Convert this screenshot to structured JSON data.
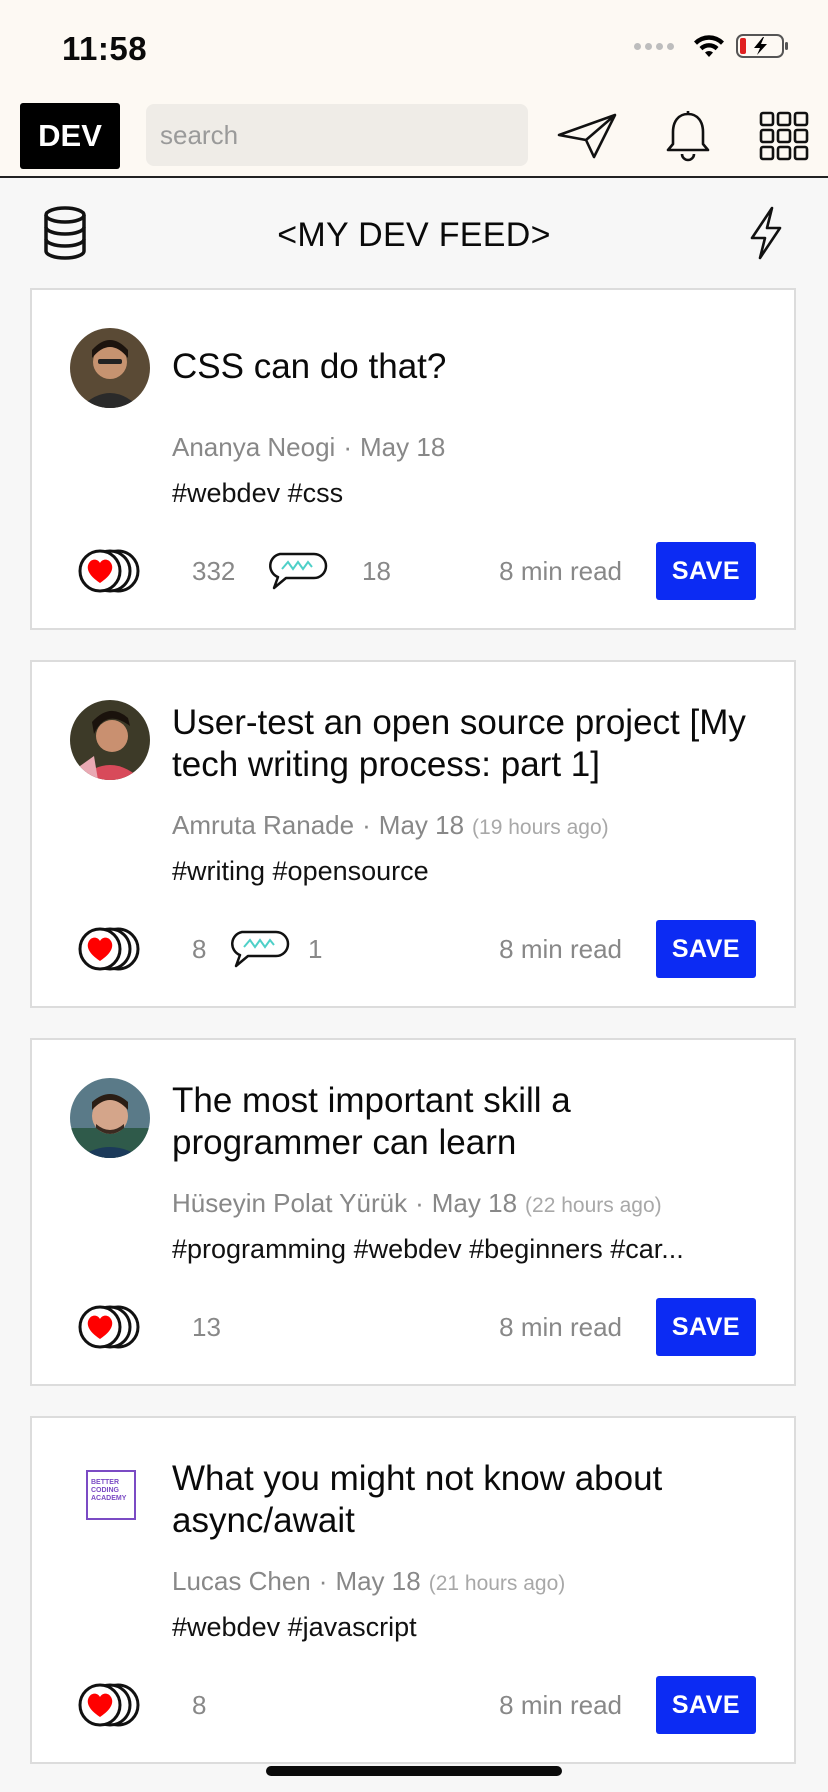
{
  "status_bar": {
    "time": "11:58"
  },
  "top_bar": {
    "logo": "DEV",
    "search_placeholder": "search",
    "icons": [
      "send-icon",
      "bell-icon",
      "grid-menu-icon"
    ]
  },
  "feed": {
    "title": "<MY DEV FEED>",
    "left_icon": "database-icon",
    "right_icon": "lightning-icon"
  },
  "posts": [
    {
      "title": "CSS can do that?",
      "author": "Ananya Neogi",
      "date": "May 18",
      "ago": "",
      "tags": "#webdev #css",
      "likes": "332",
      "comments": "18",
      "read_time": "8 min read",
      "save_label": "SAVE"
    },
    {
      "title": "User-test an open source project [My tech writing process: part 1]",
      "author": "Amruta Ranade",
      "date": "May 18",
      "ago": "(19 hours ago)",
      "tags": "#writing #opensource",
      "likes": "8",
      "comments": "1",
      "read_time": "8 min read",
      "save_label": "SAVE"
    },
    {
      "title": "The most important skill a programmer can learn",
      "author": "Hüseyin Polat Yürük",
      "date": "May 18",
      "ago": "(22 hours ago)",
      "tags": "#programming #webdev #beginners #car...",
      "likes": "13",
      "comments": "",
      "read_time": "8 min read",
      "save_label": "SAVE"
    },
    {
      "title": "What you might not know about async/await",
      "author": "Lucas Chen",
      "date": "May 18",
      "ago": "(21 hours ago)",
      "tags": "#webdev #javascript",
      "likes": "8",
      "comments": "",
      "read_time": "8 min read",
      "save_label": "SAVE",
      "avatar_logo_text": "BETTER CODING ACADEMY"
    }
  ],
  "colors": {
    "save_button": "#0c2bf3",
    "heart": "#ff0000",
    "top_bar_bg": "#fdf9f3"
  }
}
